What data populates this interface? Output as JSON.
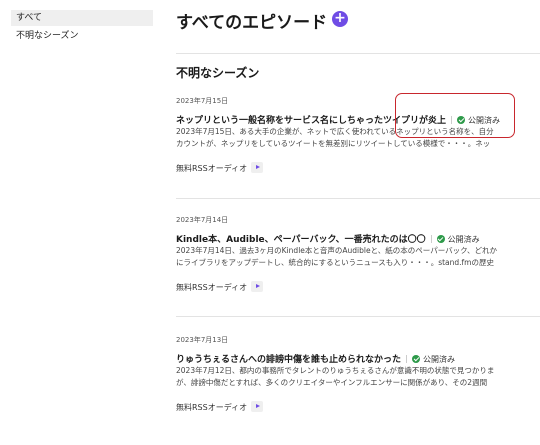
{
  "sidebar": {
    "items": [
      {
        "label": "すべて"
      },
      {
        "label": "不明なシーズン"
      }
    ]
  },
  "header": {
    "title": "すべてのエピソード",
    "add_icon": "plus-icon",
    "add_label": "+"
  },
  "season": {
    "heading": "不明なシーズン"
  },
  "episodes": [
    {
      "date": "2023年7月15日",
      "title": "ネップリという一般名称をサービス名にしちゃったツイプリが炎上",
      "status": "公開済み",
      "desc1": "2023年7月15日、ある大手の企業が、ネットで広く使われているネップリという名称を、自分",
      "desc2": "カウントが、ネップリをしているツイートを無差別にリツイートしている模様で・・・。ネッ",
      "audio_label": "無料RSSオーディオ"
    },
    {
      "date": "2023年7月14日",
      "title": "Kindle本、Audible、ペーパーバック、一番売れたのは〇〇",
      "status": "公開済み",
      "desc1": "2023年7月14日、過去3ヶ月のKindle本と音声のAudibleと、紙の本のペーパーバック、どれか",
      "desc2": "にライブラリをアップデートし、統合的にするというニュースも入り・・・。stand.fmの歴史",
      "audio_label": "無料RSSオーディオ"
    },
    {
      "date": "2023年7月13日",
      "title": "りゅうちぇるさんへの誹謗中傷を誰も止められなかった",
      "status": "公開済み",
      "desc1": "2023年7月12日、都内の事務所でタレントのりゅうちぇるさんが意識不明の状態で見つかりま",
      "desc2": "が、誹謗中傷だとすれば、多くのクリエイターやインフルエンサーに関係があり、その2週間",
      "audio_label": "無料RSSオーディオ"
    }
  ],
  "colors": {
    "accent": "#6f4ce5",
    "published": "#2e9a4a",
    "annotation": "#c8272d"
  }
}
